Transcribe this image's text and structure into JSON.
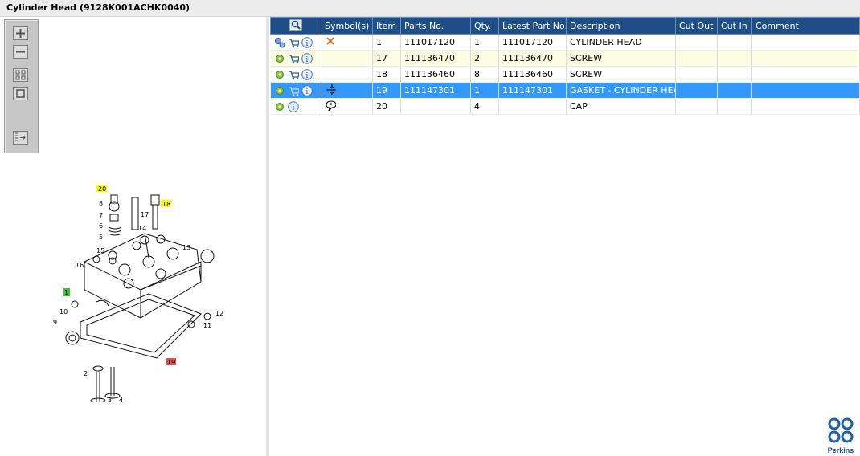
{
  "window": {
    "title": "Cylinder Head (9128K001ACHK0040)"
  },
  "toolbar": {
    "buttons": [
      "zoom-in",
      "zoom-out",
      "fit-all",
      "fit-window",
      "export"
    ]
  },
  "table": {
    "columns": [
      "",
      "Symbol(s)",
      "Item",
      "Parts No.",
      "Qty.",
      "Latest Part No.",
      "Description",
      "Cut Out",
      "Cut In",
      "Comment"
    ],
    "rows": [
      {
        "item": "1",
        "parts_no": "111017120",
        "qty": "1",
        "latest": "111017120",
        "description": "CYLINDER HEAD",
        "cut_out": "",
        "cut_in": "",
        "comment": "",
        "symbol": "cross",
        "cart": true,
        "state": "normal"
      },
      {
        "item": "17",
        "parts_no": "111136470",
        "qty": "2",
        "latest": "111136470",
        "description": "SCREW",
        "cut_out": "",
        "cut_in": "",
        "comment": "",
        "symbol": "",
        "cart": true,
        "state": "alt"
      },
      {
        "item": "18",
        "parts_no": "111136460",
        "qty": "8",
        "latest": "111136460",
        "description": "SCREW",
        "cut_out": "",
        "cut_in": "",
        "comment": "",
        "symbol": "",
        "cart": true,
        "state": "normal"
      },
      {
        "item": "19",
        "parts_no": "111147301",
        "qty": "1",
        "latest": "111147301",
        "description": "GASKET - CYLINDER HEAD",
        "cut_out": "",
        "cut_in": "",
        "comment": "",
        "symbol": "compress",
        "cart": true,
        "state": "selected"
      },
      {
        "item": "20",
        "parts_no": "",
        "qty": "4",
        "latest": "",
        "description": "CAP",
        "cut_out": "",
        "cut_in": "",
        "comment": "",
        "symbol": "note",
        "cart": false,
        "state": "normal"
      }
    ]
  },
  "diagram": {
    "callouts": [
      "20",
      "8",
      "7",
      "6",
      "5",
      "17",
      "18",
      "15",
      "16",
      "14",
      "13",
      "1",
      "10",
      "9",
      "11",
      "12",
      "19",
      "2",
      "4",
      "3"
    ]
  },
  "logo": {
    "text": "Perkins"
  },
  "colors": {
    "header_bg": "#1f4e86",
    "selected_row": "#3399ff",
    "alt_row": "#fdfde3",
    "highlight_yellow": "#ffff00",
    "highlight_green": "#33cc33",
    "highlight_red": "#e05050"
  }
}
